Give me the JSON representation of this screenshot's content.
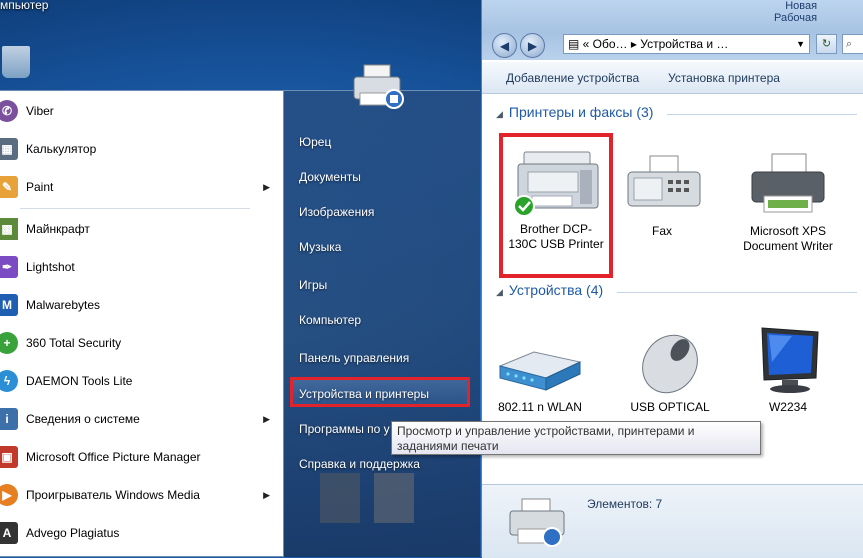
{
  "desktop": {
    "top_label": "мпьютер",
    "right_labels": [
      "Новая",
      "Рабочая"
    ]
  },
  "start_menu": {
    "programs": [
      {
        "label": "Viber",
        "icon": "viber-icon",
        "color": "#7b519d",
        "arrow": false
      },
      {
        "label": "Калькулятор",
        "icon": "calculator-icon",
        "color": "#5a6c80",
        "arrow": false
      },
      {
        "label": "Paint",
        "icon": "paint-icon",
        "color": "#e8a23a",
        "arrow": true
      },
      {
        "label": "Майнкрафт",
        "icon": "minecraft-icon",
        "color": "#5d8a3a",
        "arrow": false
      },
      {
        "label": "Lightshot",
        "icon": "lightshot-icon",
        "color": "#7a4bc2",
        "arrow": false
      },
      {
        "label": "Malwarebytes",
        "icon": "malwarebytes-icon",
        "color": "#1f5fb2",
        "arrow": false
      },
      {
        "label": "360 Total Security",
        "icon": "security-icon",
        "color": "#3aa23a",
        "arrow": false
      },
      {
        "label": "DAEMON Tools Lite",
        "icon": "daemon-tools-icon",
        "color": "#2c8fd6",
        "arrow": false
      },
      {
        "label": "Сведения о системе",
        "icon": "system-info-icon",
        "color": "#3d6fa8",
        "arrow": true
      },
      {
        "label": "Microsoft Office Picture Manager",
        "icon": "picture-manager-icon",
        "color": "#c0392b",
        "arrow": false
      },
      {
        "label": "Проигрыватель Windows Media",
        "icon": "media-player-icon",
        "color": "#e67e22",
        "arrow": true
      },
      {
        "label": "Advego Plagiatus",
        "icon": "plagiatus-icon",
        "color": "#333333",
        "arrow": false
      }
    ],
    "right_items": [
      "Юрец",
      "Документы",
      "Изображения",
      "Музыка",
      "Игры",
      "Компьютер",
      "Панель управления",
      "Устройства и принтеры",
      "Программы по у",
      "Справка и поддержка"
    ]
  },
  "tooltip": {
    "text": "Просмотр и управление устройствами, принтерами и заданиями печати"
  },
  "explorer": {
    "address": "« Обо… ▸ Устройства и …",
    "commands": [
      "Добавление устройства",
      "Установка принтера"
    ],
    "groups": [
      {
        "title": "Принтеры и факсы (3)"
      },
      {
        "title": "Устройства (4)"
      }
    ],
    "printers": [
      {
        "label": "Brother DCP-130C USB Printer",
        "icon": "mfp-printer-icon",
        "default": true
      },
      {
        "label": "Fax",
        "icon": "fax-icon",
        "default": false
      },
      {
        "label": "Microsoft XPS Document Writer",
        "icon": "xps-printer-icon",
        "default": false
      }
    ],
    "devices": [
      {
        "label": "802.11 n WLAN",
        "icon": "router-icon"
      },
      {
        "label": "USB OPTICAL",
        "icon": "mouse-icon"
      },
      {
        "label": "W2234",
        "icon": "monitor-icon"
      }
    ],
    "status": "Элементов: 7"
  },
  "colors": {
    "highlight": "#e2232b",
    "group_title": "#1e5aa8"
  }
}
